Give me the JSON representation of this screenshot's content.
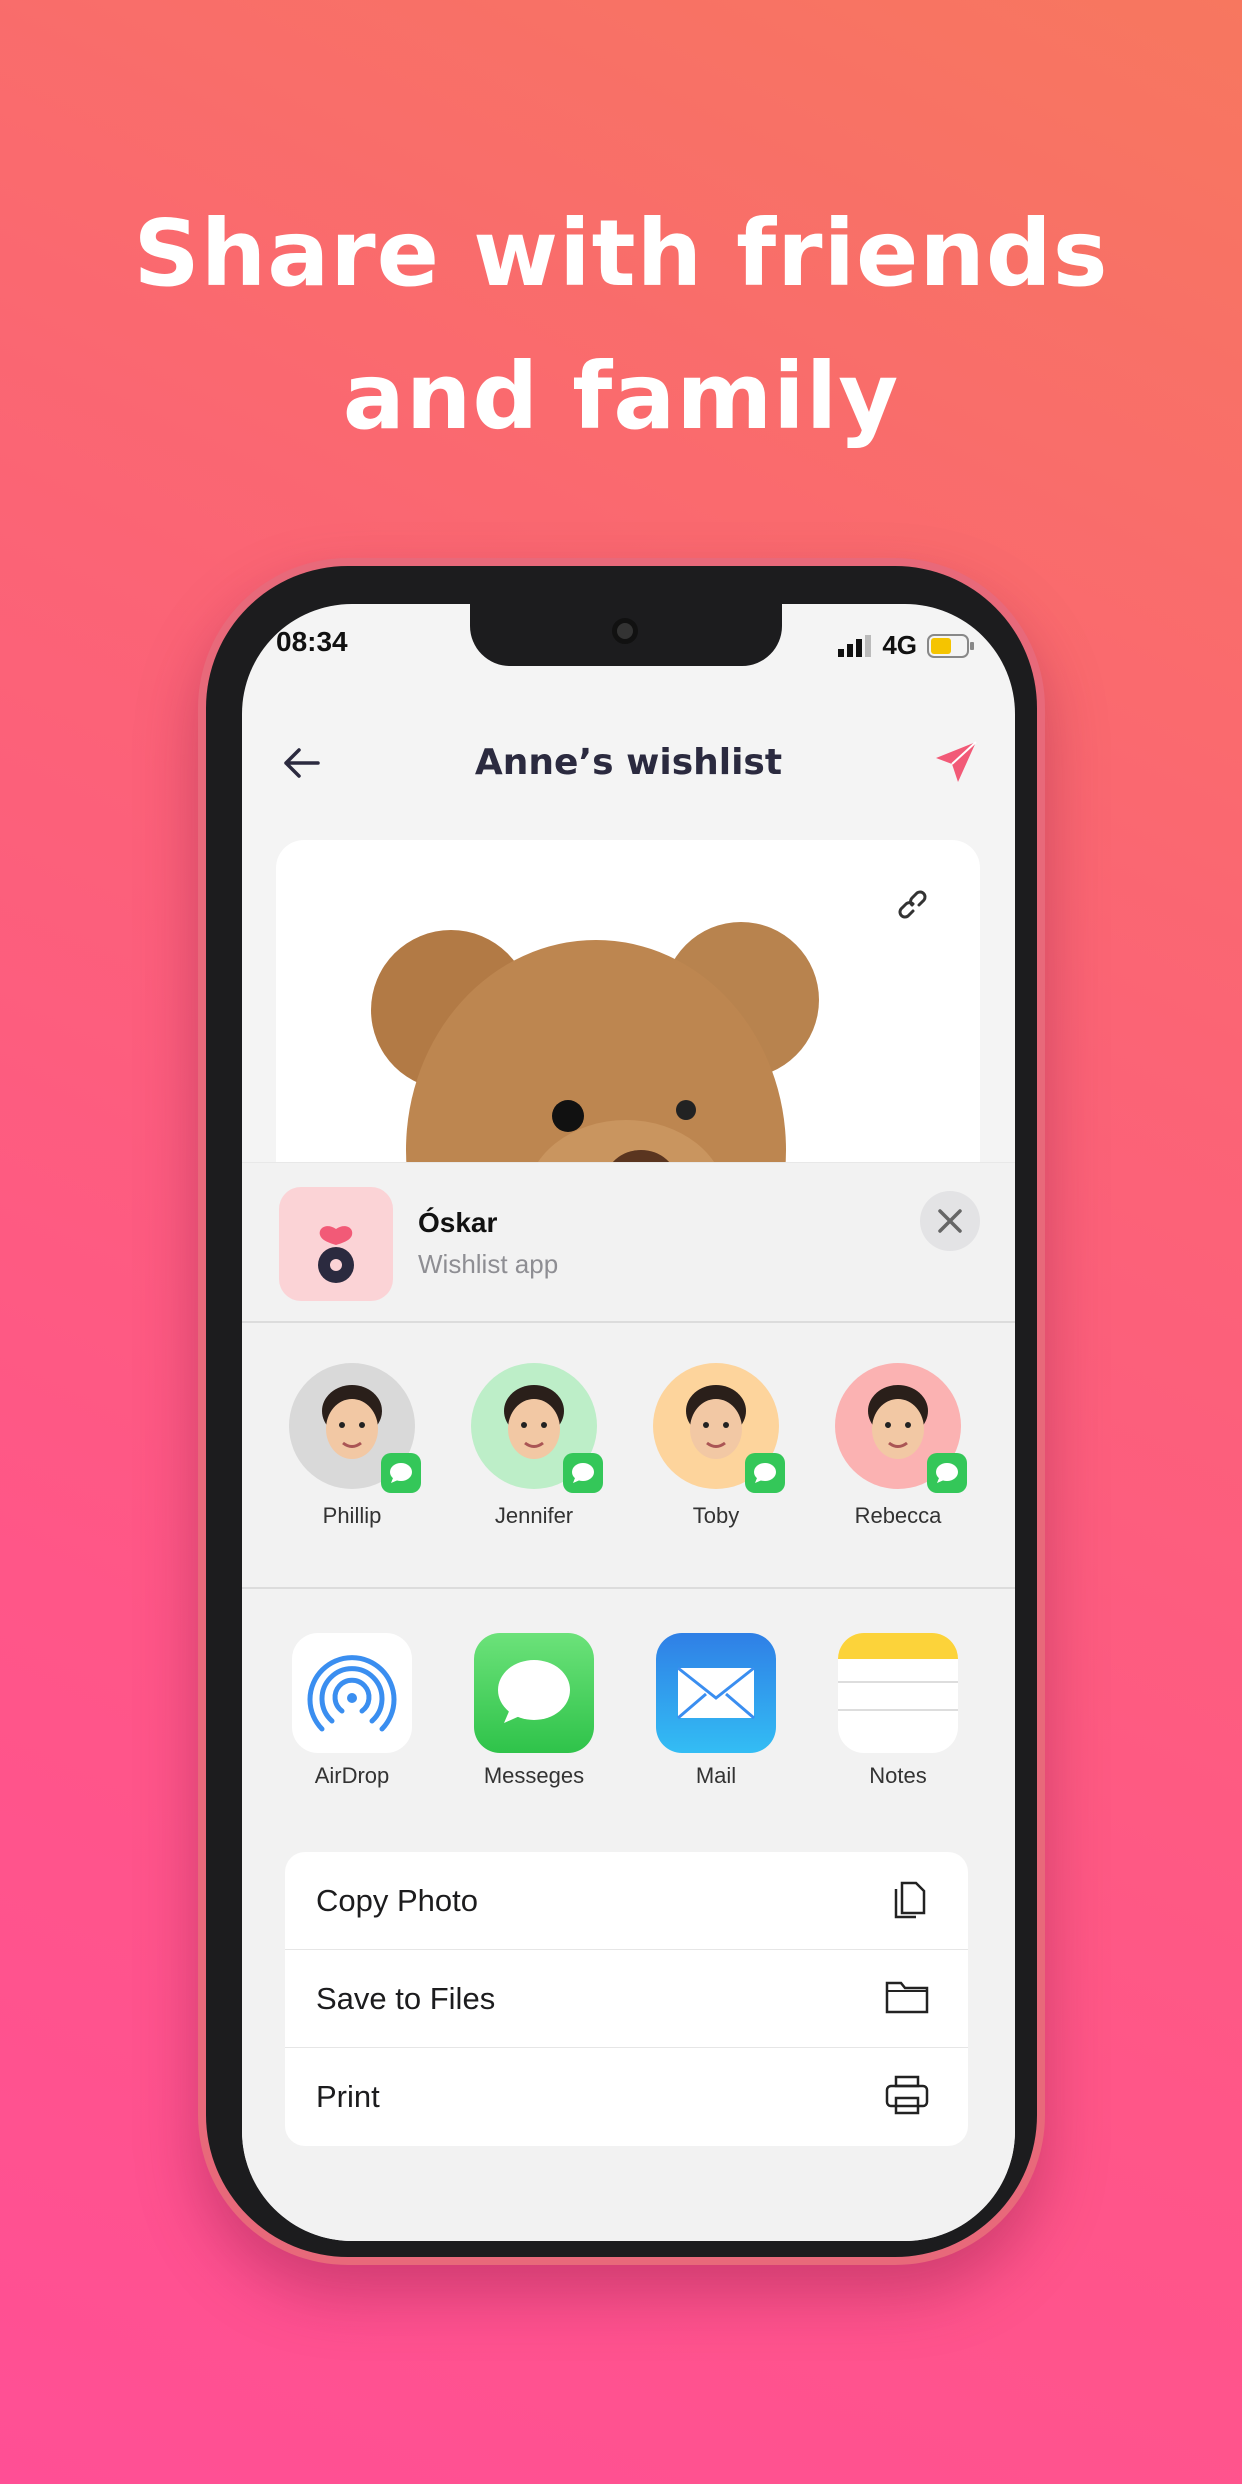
{
  "headline": {
    "line1": "Share with friends",
    "line2": "and family"
  },
  "status_bar": {
    "time": "08:34",
    "network": "4G",
    "battery_level": 0.5
  },
  "header": {
    "title": "Anne’s wishlist",
    "back_icon": "arrow-left-icon",
    "share_icon": "paper-plane-icon",
    "accent": "#f25a77"
  },
  "card": {
    "link_icon": "link-icon",
    "image": "teddy-bear"
  },
  "share_sheet": {
    "app_name": "Óskar",
    "app_subtitle": "Wishlist app",
    "contacts": [
      {
        "name": "Phillip",
        "bg": "#d9d9d9"
      },
      {
        "name": "Jennifer",
        "bg": "#bdeec8"
      },
      {
        "name": "Toby",
        "bg": "#fdd49c"
      },
      {
        "name": "Rebecca",
        "bg": "#fbb2b2"
      }
    ],
    "apps": [
      {
        "label": "AirDrop",
        "icon": "airdrop-icon"
      },
      {
        "label": "Messeges",
        "icon": "messages-icon"
      },
      {
        "label": "Mail",
        "icon": "mail-icon"
      },
      {
        "label": "Notes",
        "icon": "notes-icon"
      }
    ],
    "actions": [
      {
        "label": "Copy Photo",
        "icon": "copy-icon"
      },
      {
        "label": "Save to Files",
        "icon": "folder-icon"
      },
      {
        "label": "Print",
        "icon": "printer-icon"
      }
    ]
  }
}
